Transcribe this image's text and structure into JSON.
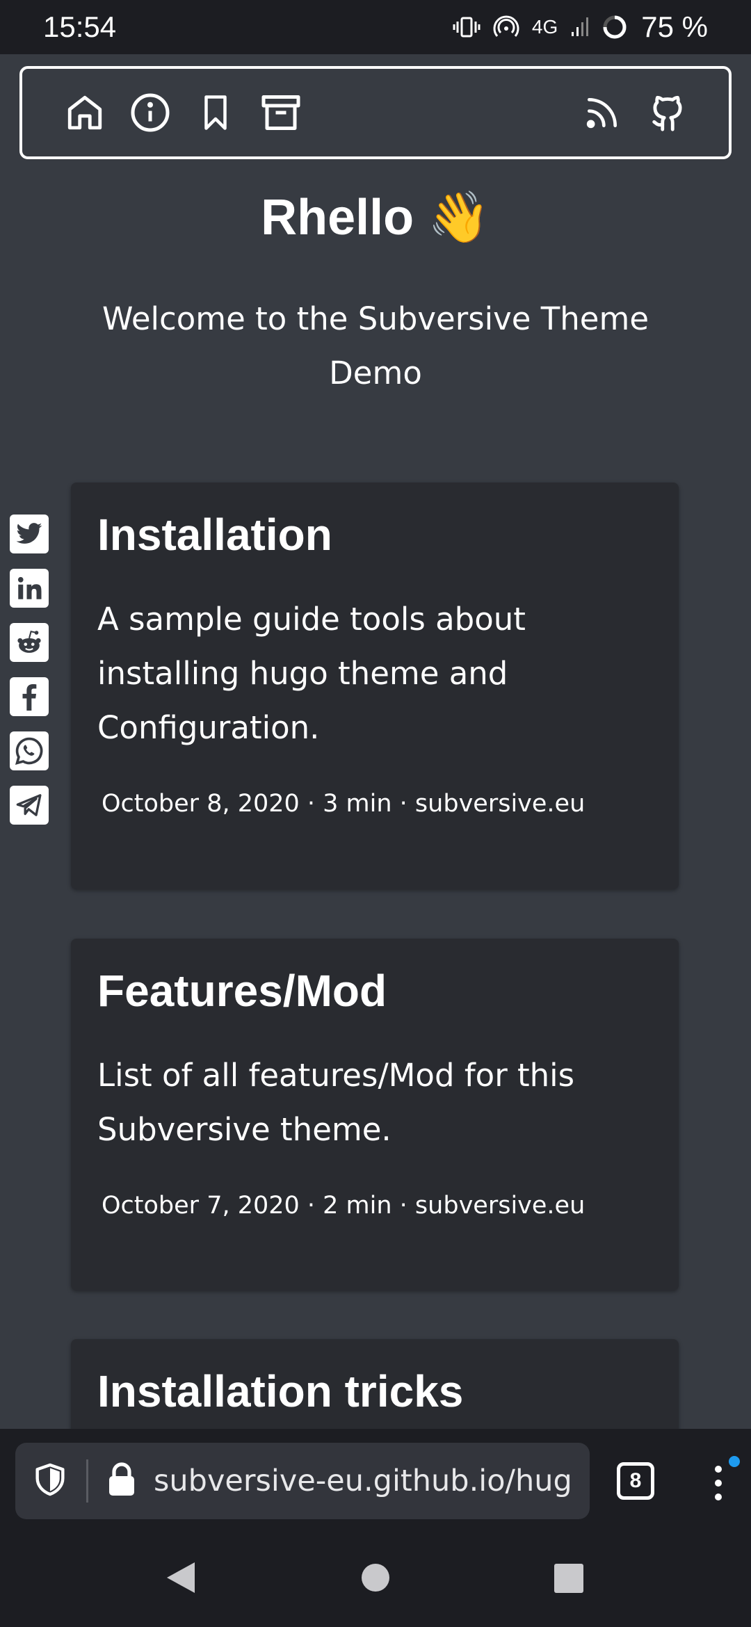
{
  "status_bar": {
    "time": "15:54",
    "network": "4G",
    "battery": "75 %"
  },
  "nav": {
    "left_icons": [
      "home-icon",
      "info-icon",
      "bookmark-icon",
      "archive-icon"
    ],
    "right_icons": [
      "rss-icon",
      "github-icon"
    ]
  },
  "site": {
    "title": "Rhello 👋",
    "subtitle": "Welcome to the Subversive Theme Demo"
  },
  "share": [
    "twitter-icon",
    "linkedin-icon",
    "reddit-icon",
    "facebook-icon",
    "whatsapp-icon",
    "telegram-icon"
  ],
  "posts": [
    {
      "title": "Installation",
      "summary": "A sample guide tools about installing hugo theme and Configuration.",
      "meta": "October 8, 2020 · 3 min · subversive.eu"
    },
    {
      "title": "Features/Mod",
      "summary": "List of all features/Mod for this Subversive theme.",
      "meta": "October 7, 2020 · 2 min · subversive.eu"
    },
    {
      "title": "Installation tricks"
    }
  ],
  "browser": {
    "url": "subversive-eu.github.io/hug",
    "tab_count": "8"
  }
}
